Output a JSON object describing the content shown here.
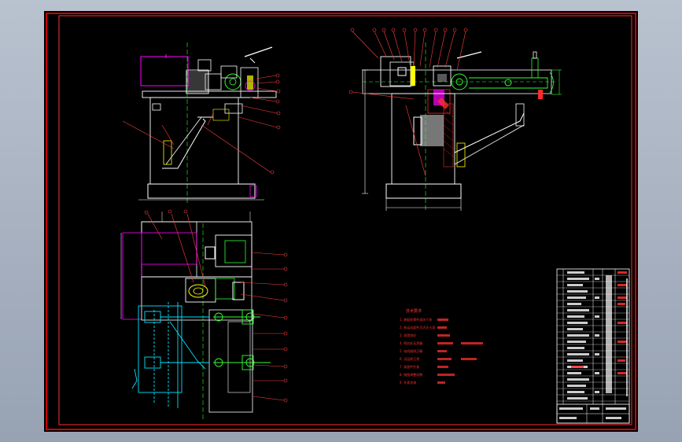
{
  "drawing": {
    "tech_requirements": {
      "title": "技术要求",
      "lines": [
        "1. 装配前零件清洗干净",
        "2. 各运动部件灵活无卡滞",
        "3. 润滑良好",
        "4. 密封处无渗漏",
        "5. 电机接线正确",
        "6. 试运转正常",
        "7. 紧固件拧紧",
        "8. 按图调整间隙",
        "9. 外表涂漆"
      ]
    },
    "colors": {
      "sheet": "#000000",
      "border": "#cc0000",
      "outline_white": "#ffffff",
      "green": "#33ff33",
      "magenta": "#ff00ff",
      "cyan": "#00e5ff",
      "yellow": "#ffff00",
      "red": "#ff2a2a"
    }
  }
}
